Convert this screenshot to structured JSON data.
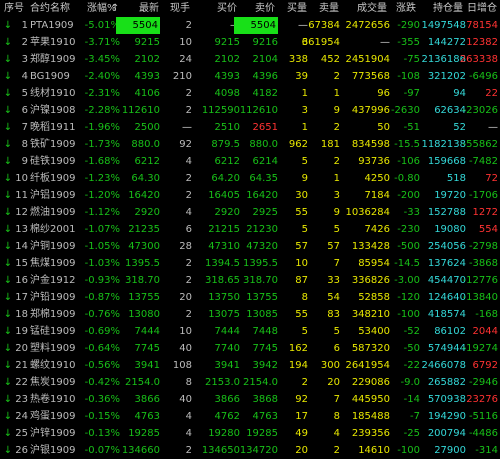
{
  "header": {
    "cols": [
      "序号",
      "合约名称",
      "涨幅%",
      "最新",
      "现手",
      "买价",
      "卖价",
      "买量",
      "卖量",
      "成交量",
      "涨跌",
      "持仓量",
      "日增仓"
    ],
    "sort_arrow": "↑"
  },
  "rows": [
    {
      "arrow": "↓",
      "no": "1",
      "name": "PTA1909",
      "pct": "-5.01%",
      "last": "5504",
      "lot": "2",
      "bid": "—",
      "ask": "5504",
      "bidv": "—",
      "askv": "67384",
      "vol": "2472656",
      "chg": "-290",
      "oi": "1497548",
      "dinc": "78154",
      "last_box": true,
      "ask_box": true
    },
    {
      "arrow": "↓",
      "no": "2",
      "name": "苹果1910",
      "pct": "-3.71%",
      "last": "9215",
      "lot": "10",
      "bid": "9215",
      "ask": "9216",
      "bidv": "6",
      "askv": "361954",
      "vol": "—",
      "chg": "-355",
      "oi": "144272",
      "dinc": "12382"
    },
    {
      "arrow": "↓",
      "no": "3",
      "name": "郑醇1909",
      "pct": "-3.45%",
      "last": "2102",
      "lot": "24",
      "bid": "2102",
      "ask": "2104",
      "bidv": "338",
      "askv": "452",
      "vol": "2451904",
      "chg": "-75",
      "oi": "2136186",
      "dinc": "263338"
    },
    {
      "arrow": "↓",
      "no": "4",
      "name": "BG1909",
      "pct": "-2.40%",
      "last": "4393",
      "lot": "210",
      "bid": "4393",
      "ask": "4396",
      "bidv": "39",
      "askv": "2",
      "vol": "773568",
      "chg": "-108",
      "oi": "321202",
      "dinc": "-6496"
    },
    {
      "arrow": "↓",
      "no": "5",
      "name": "线材1910",
      "pct": "-2.31%",
      "last": "4106",
      "lot": "2",
      "bid": "4098",
      "ask": "4182",
      "bidv": "1",
      "askv": "1",
      "vol": "96",
      "chg": "-97",
      "oi": "94",
      "dinc": "22"
    },
    {
      "arrow": "↓",
      "no": "6",
      "name": "沪镍1908",
      "pct": "-2.28%",
      "last": "112610",
      "lot": "2",
      "bid": "112590",
      "ask": "112610",
      "bidv": "3",
      "askv": "9",
      "vol": "437996",
      "chg": "-2630",
      "oi": "62634",
      "dinc": "-23026"
    },
    {
      "arrow": "↓",
      "no": "7",
      "name": "晚稻1911",
      "pct": "-1.96%",
      "last": "2500",
      "lot": "—",
      "bid": "2510",
      "ask": "2651",
      "bidv": "1",
      "askv": "2",
      "vol": "50",
      "chg": "-51",
      "oi": "52",
      "dinc": "—",
      "ask_red": true
    },
    {
      "arrow": "↓",
      "no": "8",
      "name": "铁矿1909",
      "pct": "-1.73%",
      "last": "880.0",
      "lot": "92",
      "bid": "879.5",
      "ask": "880.0",
      "bidv": "962",
      "askv": "181",
      "vol": "834598",
      "chg": "-15.5",
      "oi": "1182138",
      "dinc": "-55862"
    },
    {
      "arrow": "↓",
      "no": "9",
      "name": "硅铁1909",
      "pct": "-1.68%",
      "last": "6212",
      "lot": "4",
      "bid": "6212",
      "ask": "6214",
      "bidv": "5",
      "askv": "2",
      "vol": "93736",
      "chg": "-106",
      "oi": "159668",
      "dinc": "-7482"
    },
    {
      "arrow": "↓",
      "no": "10",
      "name": "纤板1909",
      "pct": "-1.23%",
      "last": "64.30",
      "lot": "2",
      "bid": "64.20",
      "ask": "64.35",
      "bidv": "9",
      "askv": "1",
      "vol": "4250",
      "chg": "-0.80",
      "oi": "518",
      "dinc": "72"
    },
    {
      "arrow": "↓",
      "no": "11",
      "name": "沪铝1909",
      "pct": "-1.20%",
      "last": "16420",
      "lot": "2",
      "bid": "16405",
      "ask": "16420",
      "bidv": "30",
      "askv": "3",
      "vol": "7184",
      "chg": "-200",
      "oi": "19720",
      "dinc": "-1706"
    },
    {
      "arrow": "↓",
      "no": "12",
      "name": "燃油1909",
      "pct": "-1.12%",
      "last": "2920",
      "lot": "4",
      "bid": "2920",
      "ask": "2925",
      "bidv": "55",
      "askv": "9",
      "vol": "1036284",
      "chg": "-33",
      "oi": "152788",
      "dinc": "1272"
    },
    {
      "arrow": "↓",
      "no": "13",
      "name": "棉纱2001",
      "pct": "-1.07%",
      "last": "21235",
      "lot": "6",
      "bid": "21215",
      "ask": "21230",
      "bidv": "5",
      "askv": "5",
      "vol": "7426",
      "chg": "-230",
      "oi": "19080",
      "dinc": "554"
    },
    {
      "arrow": "↓",
      "no": "14",
      "name": "沪铜1909",
      "pct": "-1.05%",
      "last": "47300",
      "lot": "28",
      "bid": "47310",
      "ask": "47320",
      "bidv": "57",
      "askv": "57",
      "vol": "133428",
      "chg": "-500",
      "oi": "254056",
      "dinc": "-2798"
    },
    {
      "arrow": "↓",
      "no": "15",
      "name": "焦煤1909",
      "pct": "-1.03%",
      "last": "1395.5",
      "lot": "2",
      "bid": "1394.5",
      "ask": "1395.5",
      "bidv": "10",
      "askv": "7",
      "vol": "85954",
      "chg": "-14.5",
      "oi": "137624",
      "dinc": "-3868"
    },
    {
      "arrow": "↓",
      "no": "16",
      "name": "沪金1912",
      "pct": "-0.93%",
      "last": "318.70",
      "lot": "2",
      "bid": "318.65",
      "ask": "318.70",
      "bidv": "87",
      "askv": "33",
      "vol": "336826",
      "chg": "-3.00",
      "oi": "454470",
      "dinc": "-12776"
    },
    {
      "arrow": "↓",
      "no": "17",
      "name": "沪铅1909",
      "pct": "-0.87%",
      "last": "13755",
      "lot": "20",
      "bid": "13750",
      "ask": "13755",
      "bidv": "8",
      "askv": "54",
      "vol": "52858",
      "chg": "-120",
      "oi": "124640",
      "dinc": "-13840"
    },
    {
      "arrow": "↓",
      "no": "18",
      "name": "郑棉1909",
      "pct": "-0.76%",
      "last": "13080",
      "lot": "2",
      "bid": "13075",
      "ask": "13085",
      "bidv": "55",
      "askv": "83",
      "vol": "348210",
      "chg": "-100",
      "oi": "418574",
      "dinc": "-168"
    },
    {
      "arrow": "↓",
      "no": "19",
      "name": "锰硅1909",
      "pct": "-0.69%",
      "last": "7444",
      "lot": "10",
      "bid": "7444",
      "ask": "7448",
      "bidv": "5",
      "askv": "5",
      "vol": "53400",
      "chg": "-52",
      "oi": "86102",
      "dinc": "2044"
    },
    {
      "arrow": "↓",
      "no": "20",
      "name": "塑料1909",
      "pct": "-0.64%",
      "last": "7745",
      "lot": "40",
      "bid": "7740",
      "ask": "7745",
      "bidv": "162",
      "askv": "6",
      "vol": "587320",
      "chg": "-50",
      "oi": "574944",
      "dinc": "-19274"
    },
    {
      "arrow": "↓",
      "no": "21",
      "name": "螺纹1910",
      "pct": "-0.56%",
      "last": "3941",
      "lot": "108",
      "bid": "3941",
      "ask": "3942",
      "bidv": "194",
      "askv": "300",
      "vol": "2641954",
      "chg": "-22",
      "oi": "2466078",
      "dinc": "6792"
    },
    {
      "arrow": "↓",
      "no": "22",
      "name": "焦炭1909",
      "pct": "-0.42%",
      "last": "2154.0",
      "lot": "8",
      "bid": "2153.0",
      "ask": "2154.0",
      "bidv": "2",
      "askv": "20",
      "vol": "229086",
      "chg": "-9.0",
      "oi": "265882",
      "dinc": "-2946"
    },
    {
      "arrow": "↓",
      "no": "23",
      "name": "热卷1910",
      "pct": "-0.36%",
      "last": "3866",
      "lot": "40",
      "bid": "3866",
      "ask": "3868",
      "bidv": "92",
      "askv": "7",
      "vol": "445950",
      "chg": "-14",
      "oi": "570938",
      "dinc": "23276"
    },
    {
      "arrow": "↓",
      "no": "24",
      "name": "鸡蛋1909",
      "pct": "-0.15%",
      "last": "4763",
      "lot": "4",
      "bid": "4762",
      "ask": "4763",
      "bidv": "17",
      "askv": "8",
      "vol": "185488",
      "chg": "-7",
      "oi": "194290",
      "dinc": "-5116"
    },
    {
      "arrow": "↓",
      "no": "25",
      "name": "沪锌1909",
      "pct": "-0.13%",
      "last": "19285",
      "lot": "4",
      "bid": "19280",
      "ask": "19285",
      "bidv": "49",
      "askv": "4",
      "vol": "239356",
      "chg": "-25",
      "oi": "200794",
      "dinc": "-4486"
    },
    {
      "arrow": "↓",
      "no": "26",
      "name": "沪银1909",
      "pct": "-0.07%",
      "last": "134660",
      "lot": "2",
      "bid": "134650",
      "ask": "134720",
      "bidv": "20",
      "askv": "2",
      "vol": "14610",
      "chg": "-100",
      "oi": "27900",
      "dinc": "-314"
    }
  ],
  "colors": {
    "background": "#000000",
    "up": "#ff3232",
    "down": "#18c018",
    "highlight": "#18e018",
    "text": "#d8d8d8",
    "volume": "#e8e800",
    "oi": "#34d8d8"
  }
}
